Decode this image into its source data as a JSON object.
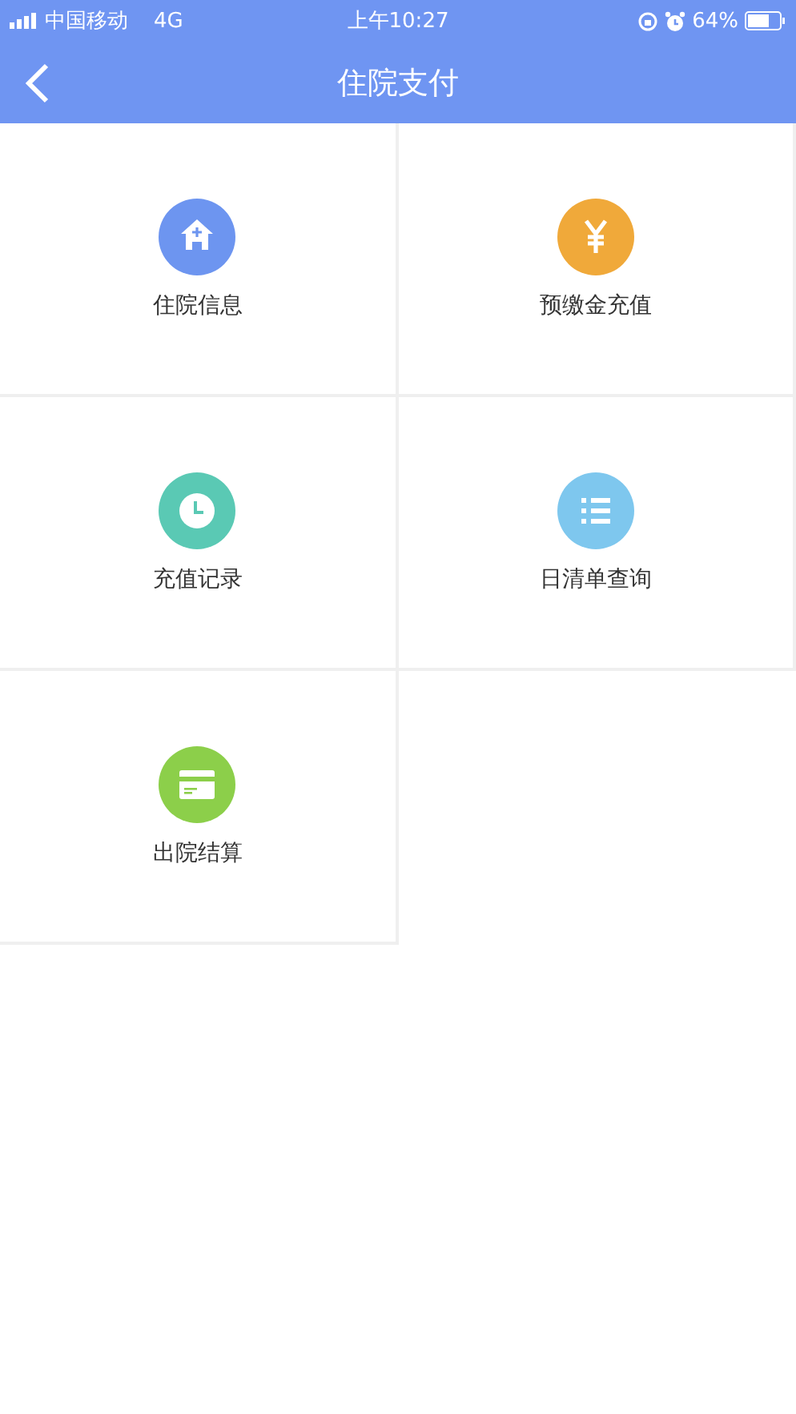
{
  "status_bar": {
    "carrier": "中国移动",
    "network": "4G",
    "time": "上午10:27",
    "battery": "64%"
  },
  "header": {
    "title": "住院支付"
  },
  "tiles": [
    {
      "label": "住院信息",
      "color": "#6d95f0"
    },
    {
      "label": "预缴金充值",
      "color": "#f0a93a"
    },
    {
      "label": "充值记录",
      "color": "#5ac9b4"
    },
    {
      "label": "日清单查询",
      "color": "#7ec7ee"
    },
    {
      "label": "出院结算",
      "color": "#8ccf4a"
    }
  ]
}
